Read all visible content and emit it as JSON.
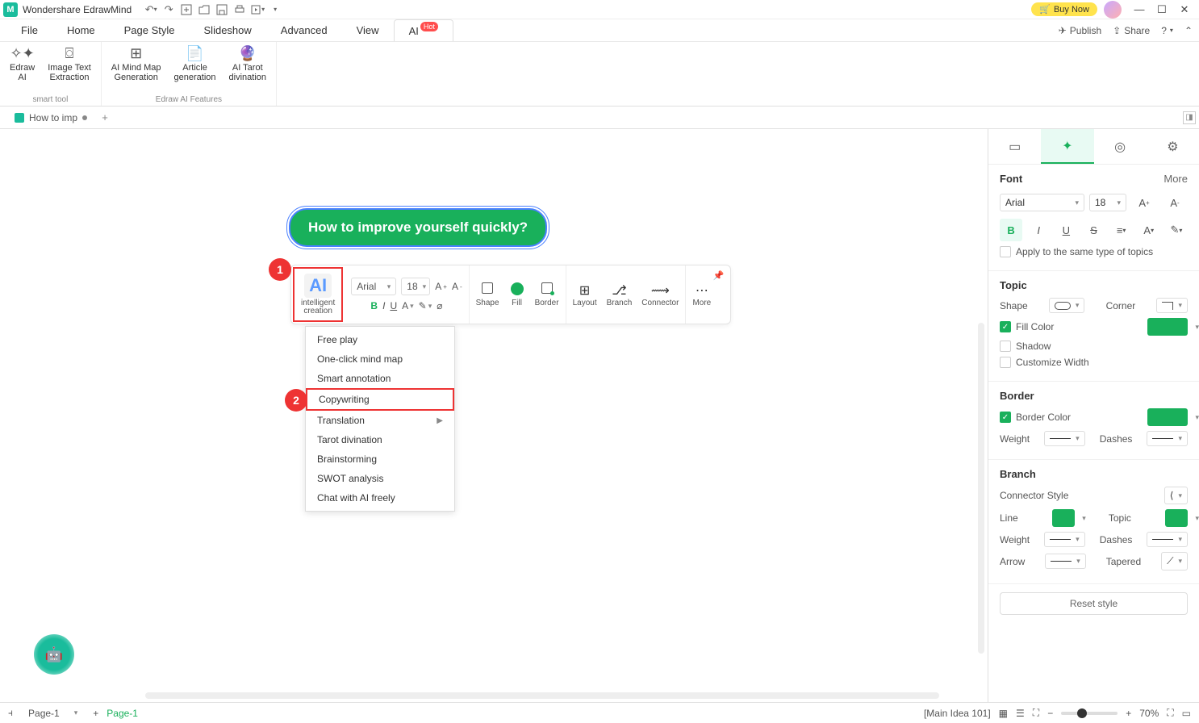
{
  "app": {
    "name": "Wondershare EdrawMind",
    "buy": "Buy Now"
  },
  "menu": {
    "items": [
      "File",
      "Home",
      "Page Style",
      "Slideshow",
      "Advanced",
      "View"
    ],
    "ai": "AI",
    "hot": "Hot",
    "publish": "Publish",
    "share": "Share"
  },
  "ribbon": {
    "group1": {
      "name": "smart tool",
      "btn1": "Edraw\nAI",
      "btn2": "Image Text\nExtraction"
    },
    "group2": {
      "name": "Edraw AI Features",
      "btn1": "AI Mind Map\nGeneration",
      "btn2": "Article\ngeneration",
      "btn3": "AI Tarot\ndivination"
    }
  },
  "doctab": {
    "name": "How to imp"
  },
  "canvas": {
    "mainNode": "How to improve yourself quickly?"
  },
  "badges": {
    "b1": "1",
    "b2": "2"
  },
  "floatbar": {
    "ai": "AI",
    "aiLabel": "intelligent\ncreation",
    "font": "Arial",
    "size": "18",
    "shape": "Shape",
    "fill": "Fill",
    "border": "Border",
    "layout": "Layout",
    "branch": "Branch",
    "connector": "Connector",
    "more": "More"
  },
  "dropdown": {
    "items": [
      "Free play",
      "One-click mind map",
      "Smart annotation",
      "Copywriting",
      "Translation",
      "Tarot divination",
      "Brainstorming",
      "SWOT analysis",
      "Chat with AI freely"
    ],
    "highlightedIndex": 3,
    "submenuIndex": 4
  },
  "rpanel": {
    "font": {
      "title": "Font",
      "more": "More",
      "family": "Arial",
      "size": "18",
      "apply": "Apply to the same type of topics"
    },
    "topic": {
      "title": "Topic",
      "shape": "Shape",
      "corner": "Corner",
      "fill": "Fill Color",
      "shadow": "Shadow",
      "customw": "Customize Width"
    },
    "border": {
      "title": "Border",
      "color": "Border Color",
      "weight": "Weight",
      "dashes": "Dashes"
    },
    "branch": {
      "title": "Branch",
      "connstyle": "Connector Style",
      "line": "Line",
      "topic": "Topic",
      "weight": "Weight",
      "dashes": "Dashes",
      "arrow": "Arrow",
      "tapered": "Tapered"
    },
    "reset": "Reset style"
  },
  "status": {
    "page": "Page-1",
    "pageActive": "Page-1",
    "info": "[Main Idea 101]",
    "zoom": "70%"
  }
}
